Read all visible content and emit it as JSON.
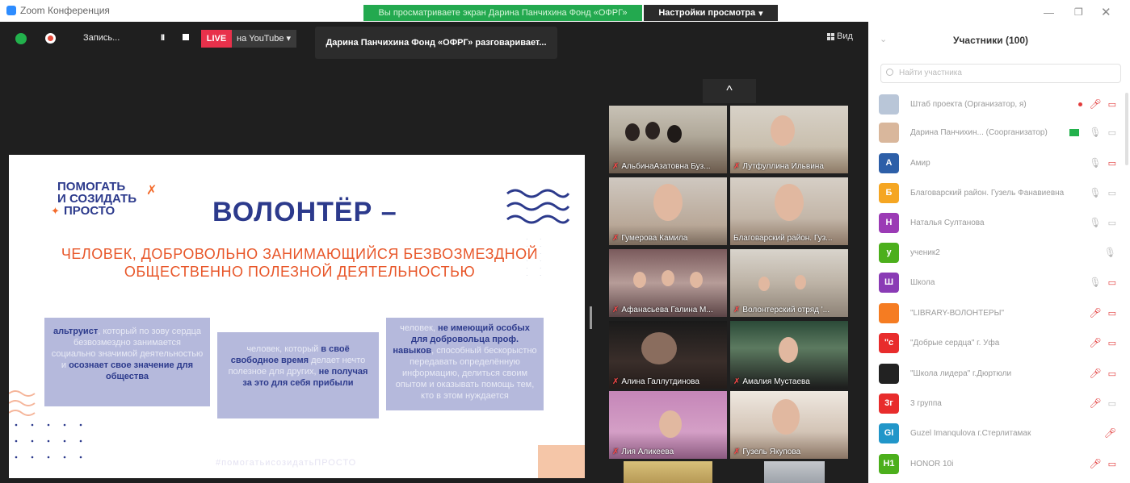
{
  "window": {
    "app_title": "Zoom Конференция",
    "viewing_banner": "Вы просматриваете экран Дарина Панчихина Фонд «ОФРГ»",
    "view_settings": "Настройки просмотра"
  },
  "toolbar": {
    "record_label": "Запись...",
    "pause_label": "II",
    "live_label": "LIVE",
    "youtube_label": "на YouTube",
    "speaker_banner": "Дарина Панчихина Фонд «ОФРГ» разговаривает...",
    "view_label": "Вид"
  },
  "slide": {
    "logo_line1": "ПОМОГАТЬ",
    "logo_line2": "И СОЗИДАТЬ",
    "logo_line3": "ПРОСТО",
    "title": "ВОЛОНТЁР –",
    "definition": "ЧЕЛОВЕК, ДОБРОВОЛЬНО ЗАНИМАЮЩИЙСЯ БЕЗВОЗМЕЗДНОЙ ОБЩЕСТВЕННО ПОЛЕЗНОЙ ДЕЯТЕЛЬНОСТЬЮ",
    "card1_bold1": "альтруист",
    "card1_text1": ", который по зову сердца безвозмездно занимается социально значимой деятельностью и",
    "card1_bold2": "осознает свое значение для общества",
    "card2_text1": "человек, который",
    "card2_bold1": "в своё свободное время",
    "card2_text2": "делает нечто полезное для других,",
    "card2_bold2": "не получая за это для себя прибыли",
    "card3_text1": "человек,",
    "card3_bold1": "не имеющий особых для добровольца проф. навыков",
    "card3_text2": ", способный бескорыстно передавать определённую информацию, делиться своим опытом и оказывать помощь тем, кто в этом нуждается",
    "hashtag": "#помогатьисозидатьПРОСТО"
  },
  "video": {
    "collapse_label": "^",
    "tiles": [
      {
        "name": "АльбинаАзатовна Буз...",
        "muted": true
      },
      {
        "name": "Лутфуллина Ильвина",
        "muted": true
      },
      {
        "name": "Гумерова Камила",
        "muted": true
      },
      {
        "name": "Благоварский район. Гуз...",
        "muted": false
      },
      {
        "name": "Афанасьева Галина М...",
        "muted": true
      },
      {
        "name": "Волонтерский отряд '...",
        "muted": true
      },
      {
        "name": "Алина Галлутдинова",
        "muted": true
      },
      {
        "name": "Амалия Мустаева",
        "muted": true
      },
      {
        "name": "Лия Аликеева",
        "muted": true
      },
      {
        "name": "Гузель Якупова",
        "muted": true
      }
    ]
  },
  "panel": {
    "title": "Участники (100)",
    "search_placeholder": "Найти участника",
    "participants": [
      {
        "initials": "",
        "name": "Штаб проекта (Организатор, я)",
        "color": "#b9c6d8",
        "mic": "muted",
        "cam": "off"
      },
      {
        "initials": "",
        "name": "Дарина Панчихин... (Соорганизатор)",
        "color": "#d9b79c",
        "mic": "on",
        "cam": "on"
      },
      {
        "initials": "А",
        "name": "Амир",
        "color": "#2d5fa8",
        "mic": "on",
        "cam": "off"
      },
      {
        "initials": "Б",
        "name": "Благоварский район. Гузель Фанавиевна",
        "color": "#f5a623",
        "mic": "on",
        "cam": "on"
      },
      {
        "initials": "Н",
        "name": "Наталья Султанова",
        "color": "#9b3bb5",
        "mic": "on",
        "cam": "on"
      },
      {
        "initials": "у",
        "name": "ученик2",
        "color": "#4caf1c",
        "mic": "on",
        "cam": "none"
      },
      {
        "initials": "Ш",
        "name": "Школа",
        "color": "#8a3bb5",
        "mic": "on",
        "cam": "off"
      },
      {
        "initials": "",
        "name": "\"LIBRARY-ВОЛОНТЕРЫ\"",
        "color": "#f57c22",
        "mic": "muted",
        "cam": "off"
      },
      {
        "initials": "\"с",
        "name": "\"Добрые сердца\" г. Уфа",
        "color": "#e82c2c",
        "mic": "muted",
        "cam": "off"
      },
      {
        "initials": "",
        "name": "\"Школа лидера\" г.Дюртюли",
        "color": "#222222",
        "mic": "muted",
        "cam": "off"
      },
      {
        "initials": "3г",
        "name": "3 группа",
        "color": "#e82c2c",
        "mic": "muted",
        "cam": "on"
      },
      {
        "initials": "GI",
        "name": "Guzel Imanqulova г.Стерлитамак",
        "color": "#2196c9",
        "mic": "muted",
        "cam": "none"
      },
      {
        "initials": "H1",
        "name": "HONOR 10i",
        "color": "#4caf1c",
        "mic": "muted",
        "cam": "off"
      }
    ]
  }
}
